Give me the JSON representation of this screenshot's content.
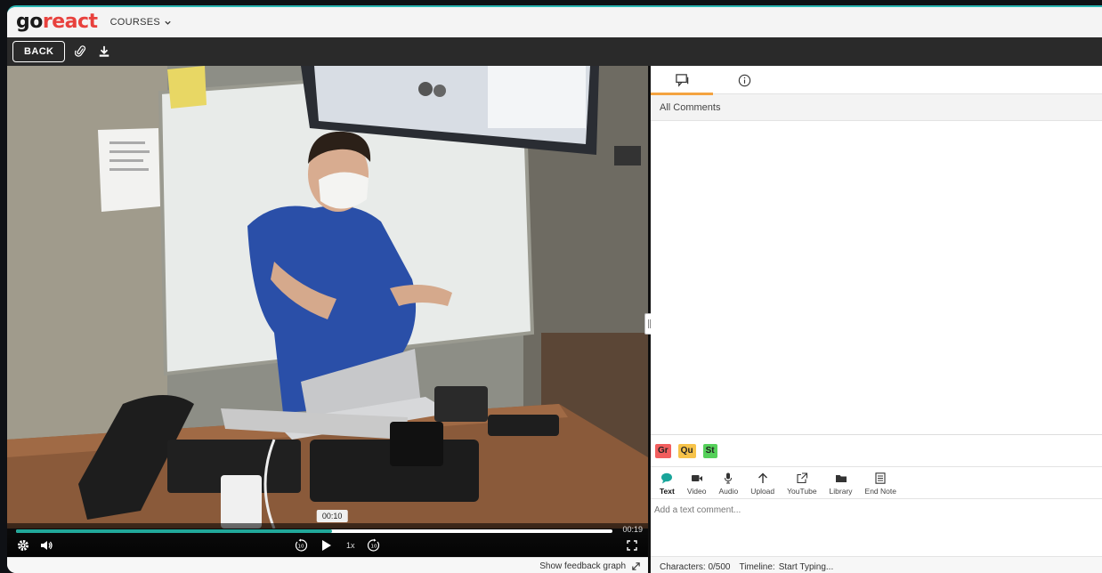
{
  "app": {
    "logo_go": "go",
    "logo_react": "react",
    "courses_label": "COURSES"
  },
  "toolbar": {
    "back_label": "BACK",
    "icons": [
      "paperclip-icon",
      "download-icon"
    ]
  },
  "player": {
    "current_time": "00:10",
    "end_time": "00:19",
    "progress": 0.53,
    "speed_label": "1x",
    "rewind_seconds": "10",
    "forward_seconds": "10"
  },
  "feedback": {
    "graph_label": "Show feedback graph"
  },
  "panel": {
    "tabs": [
      {
        "icon": "comment-icon",
        "active": true
      },
      {
        "icon": "info-icon",
        "active": false
      }
    ],
    "filter_label": "All Comments",
    "tags": [
      "Gr",
      "Qu",
      "St"
    ],
    "comment_types": [
      {
        "label": "Text",
        "icon": "speech-bubble-icon"
      },
      {
        "label": "Video",
        "icon": "video-camera-icon"
      },
      {
        "label": "Audio",
        "icon": "microphone-icon"
      },
      {
        "label": "Upload",
        "icon": "upload-arrow-icon"
      },
      {
        "label": "YouTube",
        "icon": "external-link-icon"
      },
      {
        "label": "Library",
        "icon": "folder-icon"
      },
      {
        "label": "End Note",
        "icon": "note-icon"
      }
    ],
    "comment_placeholder": "Add a text comment...",
    "characters_label": "Characters: 0/500",
    "timeline_label": "Timeline:",
    "timeline_value": "Start Typing..."
  },
  "colors": {
    "accent_teal": "#21a89a",
    "tab_active": "#f4a340",
    "logo_red": "#e8413d",
    "tag_gr": "#f25e5e",
    "tag_qu": "#f7c34a",
    "tag_st": "#55d05a"
  }
}
